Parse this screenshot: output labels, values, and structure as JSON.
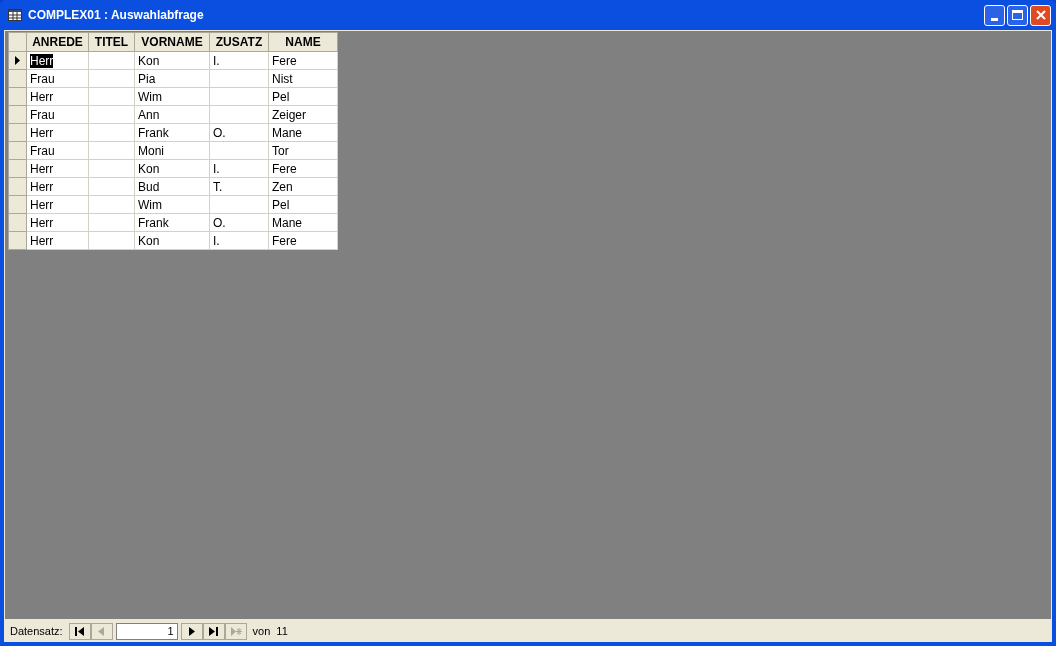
{
  "window": {
    "title": "COMPLEX01 : Auswahlabfrage"
  },
  "table": {
    "columns": [
      "ANREDE",
      "TITEL",
      "VORNAME",
      "ZUSATZ",
      "NAME"
    ],
    "rows": [
      {
        "cells": [
          "Herr",
          "",
          "Kon",
          "I.",
          "Fere"
        ],
        "selected": true
      },
      {
        "cells": [
          "Frau",
          "",
          "Pia",
          "",
          "Nist"
        ],
        "selected": false
      },
      {
        "cells": [
          "Herr",
          "",
          "Wim",
          "",
          "Pel"
        ],
        "selected": false
      },
      {
        "cells": [
          "Frau",
          "",
          "Ann",
          "",
          "Zeiger"
        ],
        "selected": false
      },
      {
        "cells": [
          "Herr",
          "",
          "Frank",
          "O.",
          "Mane"
        ],
        "selected": false
      },
      {
        "cells": [
          "Frau",
          "",
          "Moni",
          "",
          "Tor"
        ],
        "selected": false
      },
      {
        "cells": [
          "Herr",
          "",
          "Kon",
          "I.",
          "Fere"
        ],
        "selected": false
      },
      {
        "cells": [
          "Herr",
          "",
          "Bud",
          "T.",
          "Zen"
        ],
        "selected": false
      },
      {
        "cells": [
          "Herr",
          "",
          "Wim",
          "",
          "Pel"
        ],
        "selected": false
      },
      {
        "cells": [
          "Herr",
          "",
          "Frank",
          "O.",
          "Mane"
        ],
        "selected": false
      },
      {
        "cells": [
          "Herr",
          "",
          "Kon",
          "I.",
          "Fere"
        ],
        "selected": false
      }
    ]
  },
  "navigation": {
    "label": "Datensatz:",
    "record": "1",
    "of_label": "von",
    "total": "11",
    "buttons": [
      {
        "kind": "first",
        "disabled": false
      },
      {
        "kind": "previous",
        "disabled": true
      },
      {
        "kind": "field"
      },
      {
        "kind": "next",
        "disabled": false
      },
      {
        "kind": "last",
        "disabled": false
      },
      {
        "kind": "new",
        "disabled": true
      }
    ]
  }
}
